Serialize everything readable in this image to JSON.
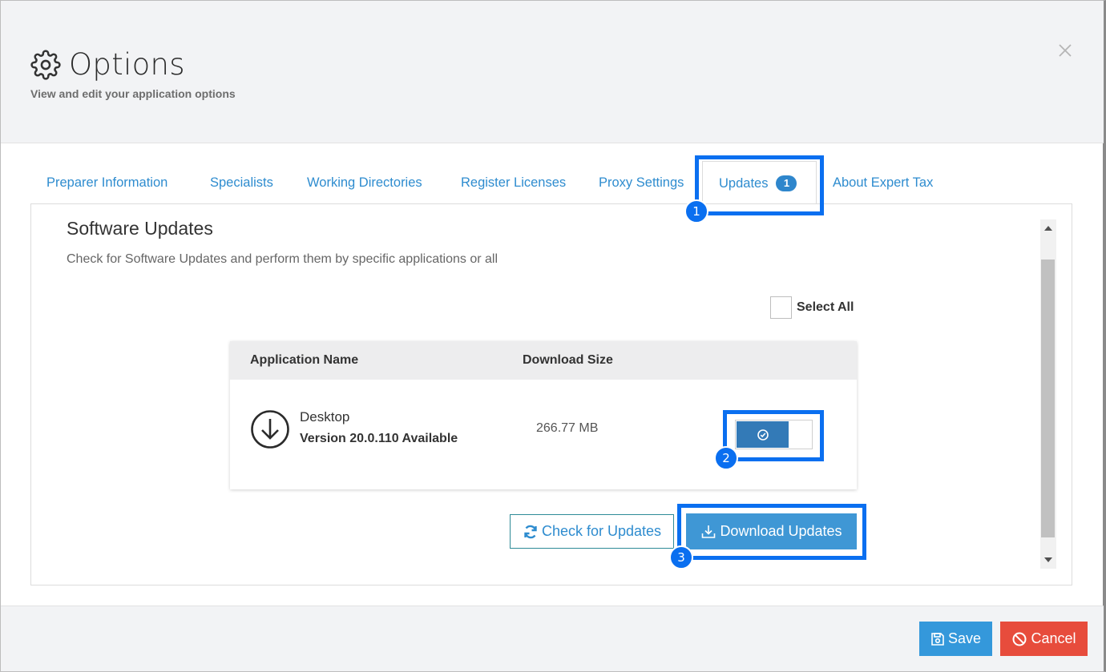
{
  "dialog": {
    "title": "Options",
    "subtitle": "View and edit your application options",
    "close_icon": "close-icon",
    "settings_icon": "gear-icon"
  },
  "tabs": [
    {
      "label": "Preparer Information",
      "active": false
    },
    {
      "label": "Specialists",
      "active": false
    },
    {
      "label": "Working Directories",
      "active": false
    },
    {
      "label": "Register Licenses",
      "active": false
    },
    {
      "label": "Proxy Settings",
      "active": false
    },
    {
      "label": "Updates",
      "active": true,
      "badge": "1"
    },
    {
      "label": "About Expert Tax",
      "active": false
    }
  ],
  "updates": {
    "title": "Software Updates",
    "description": "Check for Software Updates and perform them by specific applications or all",
    "select_all_label": "Select All",
    "select_all_checked": false,
    "table": {
      "columns": [
        "Application Name",
        "Download Size"
      ],
      "rows": [
        {
          "name": "Desktop",
          "version": "Version 20.0.110 Available",
          "size": "266.77 MB",
          "selected": true,
          "icon": "download-circle-icon"
        }
      ]
    },
    "check_button": "Check for Updates",
    "download_button": "Download Updates"
  },
  "footer": {
    "save": "Save",
    "cancel": "Cancel"
  },
  "annotations": {
    "markers": [
      "1",
      "2",
      "3"
    ],
    "color": "#0a6ff0"
  },
  "colors": {
    "link": "#2e8ccf",
    "primary": "#3498db",
    "toggle_on": "#337ab7",
    "danger": "#e74c3c",
    "highlight": "#0a6ff0"
  }
}
